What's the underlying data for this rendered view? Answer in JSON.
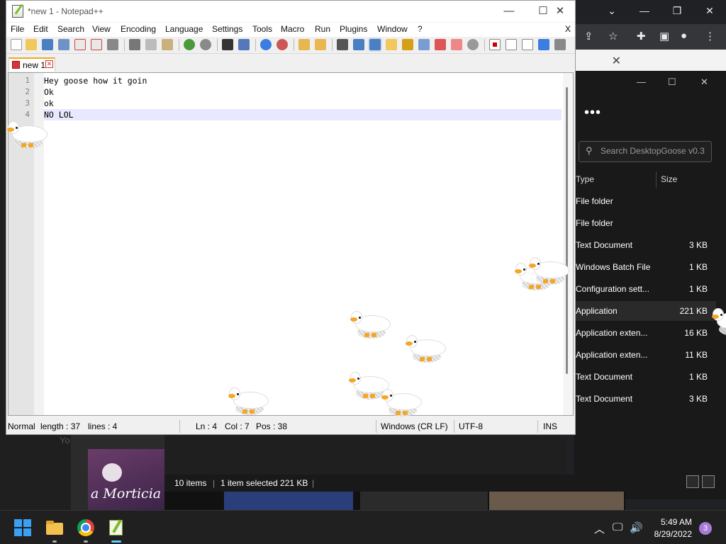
{
  "browser": {
    "controls": [
      "⌄",
      "—",
      "❐",
      "✕"
    ]
  },
  "explorer": {
    "search_placeholder": "Search DesktopGoose v0.3",
    "columns": {
      "type": "Type",
      "size": "Size"
    },
    "rows": [
      {
        "type": "File folder",
        "size": ""
      },
      {
        "type": "File folder",
        "size": ""
      },
      {
        "type": "Text Document",
        "size": "3 KB"
      },
      {
        "type": "Windows Batch File",
        "size": "1 KB"
      },
      {
        "type": "Configuration sett...",
        "size": "1 KB"
      },
      {
        "type": "Application",
        "size": "221 KB"
      },
      {
        "type": "Application exten...",
        "size": "16 KB"
      },
      {
        "type": "Application exten...",
        "size": "11 KB"
      },
      {
        "type": "Text Document",
        "size": "1 KB"
      },
      {
        "type": "Text Document",
        "size": "3 KB"
      }
    ],
    "selected_index": 5,
    "status": {
      "items": "10 items",
      "selected": "1 item selected  221 KB"
    },
    "poster_text": "a Morticia",
    "yo": "Yo"
  },
  "npp": {
    "title": "*new 1 - Notepad++",
    "menu": [
      "File",
      "Edit",
      "Search",
      "View",
      "Encoding",
      "Language",
      "Settings",
      "Tools",
      "Macro",
      "Run",
      "Plugins",
      "Window",
      "?"
    ],
    "close_doc": "X",
    "tab_label": "new 1",
    "lines": [
      {
        "num": "1",
        "text": "Hey goose how it goin"
      },
      {
        "num": "2",
        "text": "Ok"
      },
      {
        "num": "3",
        "text": "ok"
      },
      {
        "num": "4",
        "text": "NO LOL"
      }
    ],
    "current_line": 4,
    "status": {
      "mode": "Normal",
      "length": "length : 37",
      "lines": "lines : 4",
      "ln": "Ln : 4",
      "col": "Col : 7",
      "pos": "Pos : 38",
      "eol": "Windows (CR LF)",
      "encoding": "UTF-8",
      "ins": "INS"
    }
  },
  "taskbar": {
    "time": "5:49 AM",
    "date": "8/29/2022",
    "notification_count": "3"
  },
  "colors": {
    "accent_orange": "#f5a623",
    "current_line": "#e8e8ff",
    "taskbar": "#202020"
  }
}
